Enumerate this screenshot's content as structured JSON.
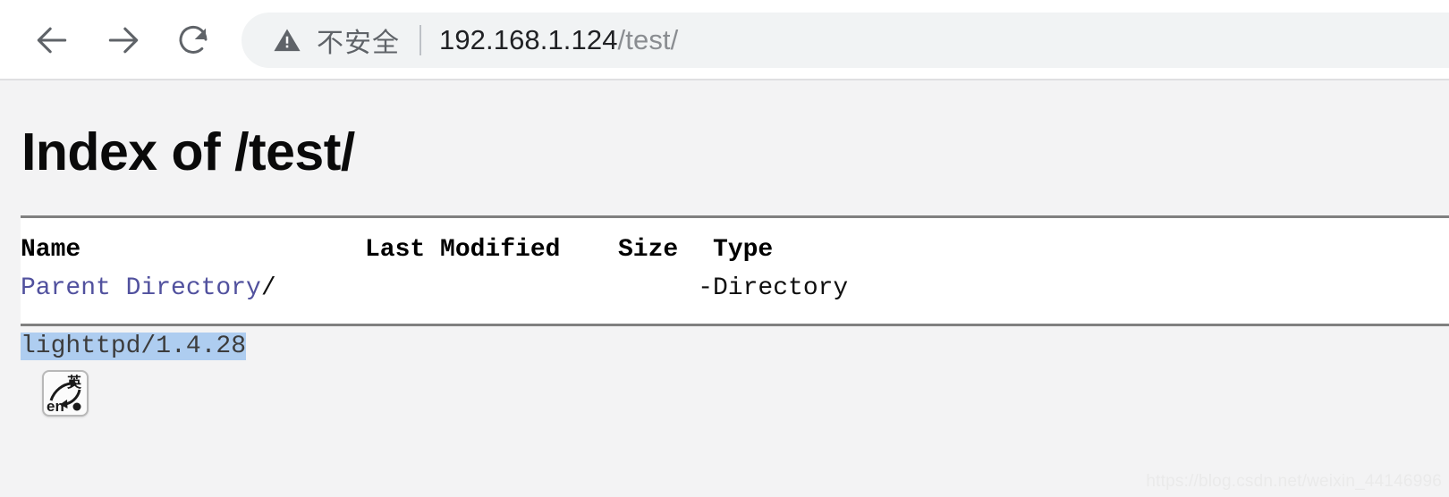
{
  "browser": {
    "back_label": "Back",
    "forward_label": "Forward",
    "reload_label": "Reload",
    "security_label": "不安全",
    "url_host": "192.168.1.124",
    "url_path": "/test/",
    "url_full": "192.168.1.124/test/"
  },
  "page": {
    "title": "Index of /test/",
    "table": {
      "headers": [
        "Name",
        "Last Modified",
        "Size",
        "Type"
      ],
      "rows": [
        {
          "name_link": "Parent Directory",
          "name_suffix": "/",
          "last_modified": "",
          "size": "-",
          "type": "Directory"
        }
      ]
    },
    "footer": {
      "server_signature": "lighttpd/1.4.28"
    }
  },
  "ime": {
    "mode_label": "en",
    "lang_label": "英"
  },
  "watermark": {
    "text": "https://blog.csdn.net/weixin_44146996"
  },
  "colors": {
    "page_background": "#f3f3f4",
    "table_background": "#ffffff",
    "rule": "#808080",
    "link": "#51519e",
    "selection": "#aecdf0",
    "omnibox": "#f1f3f4",
    "chrome_icon": "#5f6368"
  }
}
